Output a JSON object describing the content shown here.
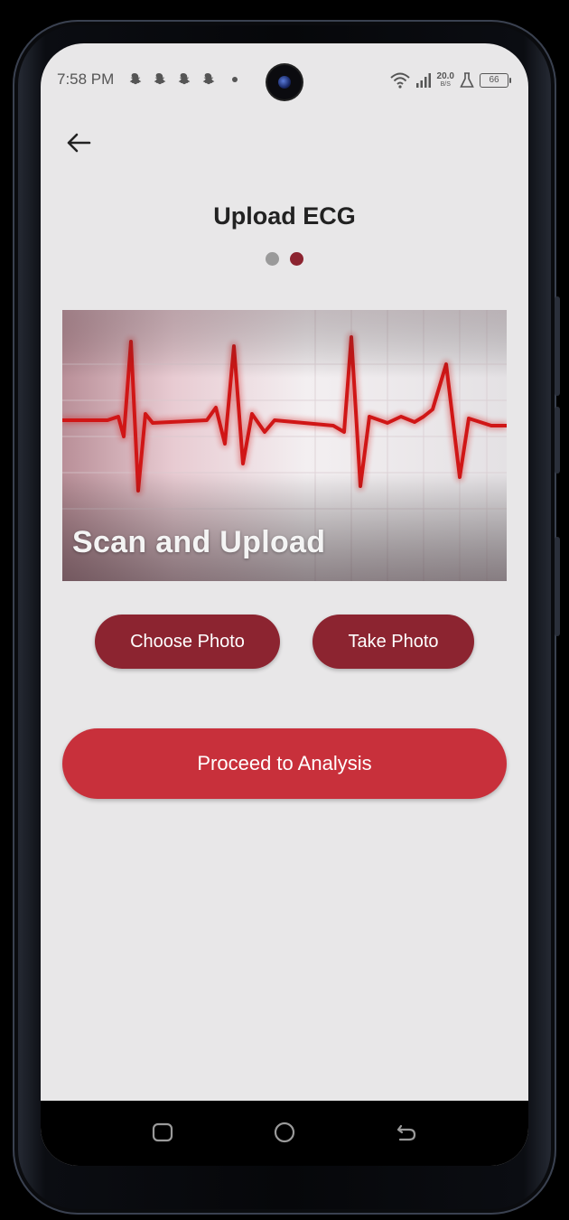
{
  "status_bar": {
    "time": "7:58 PM",
    "net_speed_value": "20.0",
    "net_speed_unit": "B/S",
    "battery": "66",
    "icons": [
      "snapchat-icon",
      "snapchat-icon",
      "snapchat-icon",
      "snapchat-icon",
      "wifi-icon",
      "signal-icon",
      "flask-icon",
      "battery-icon"
    ]
  },
  "header": {
    "back_icon": "arrow-left-icon",
    "title": "Upload ECG"
  },
  "pager": {
    "total": 2,
    "active_index": 1,
    "inactive_color": "#9a9a9a",
    "active_color": "#8c2430"
  },
  "hero": {
    "caption": "Scan and Upload"
  },
  "actions": {
    "choose_photo": "Choose Photo",
    "take_photo": "Take Photo",
    "proceed": "Proceed to Analysis"
  },
  "colors": {
    "background": "#e8e7e8",
    "button_dark_red": "#8c2430",
    "button_red": "#c8303b",
    "ecg_line": "#d01616"
  },
  "nav_bar": {
    "icons": [
      "recents-icon",
      "home-icon",
      "back-icon"
    ]
  }
}
